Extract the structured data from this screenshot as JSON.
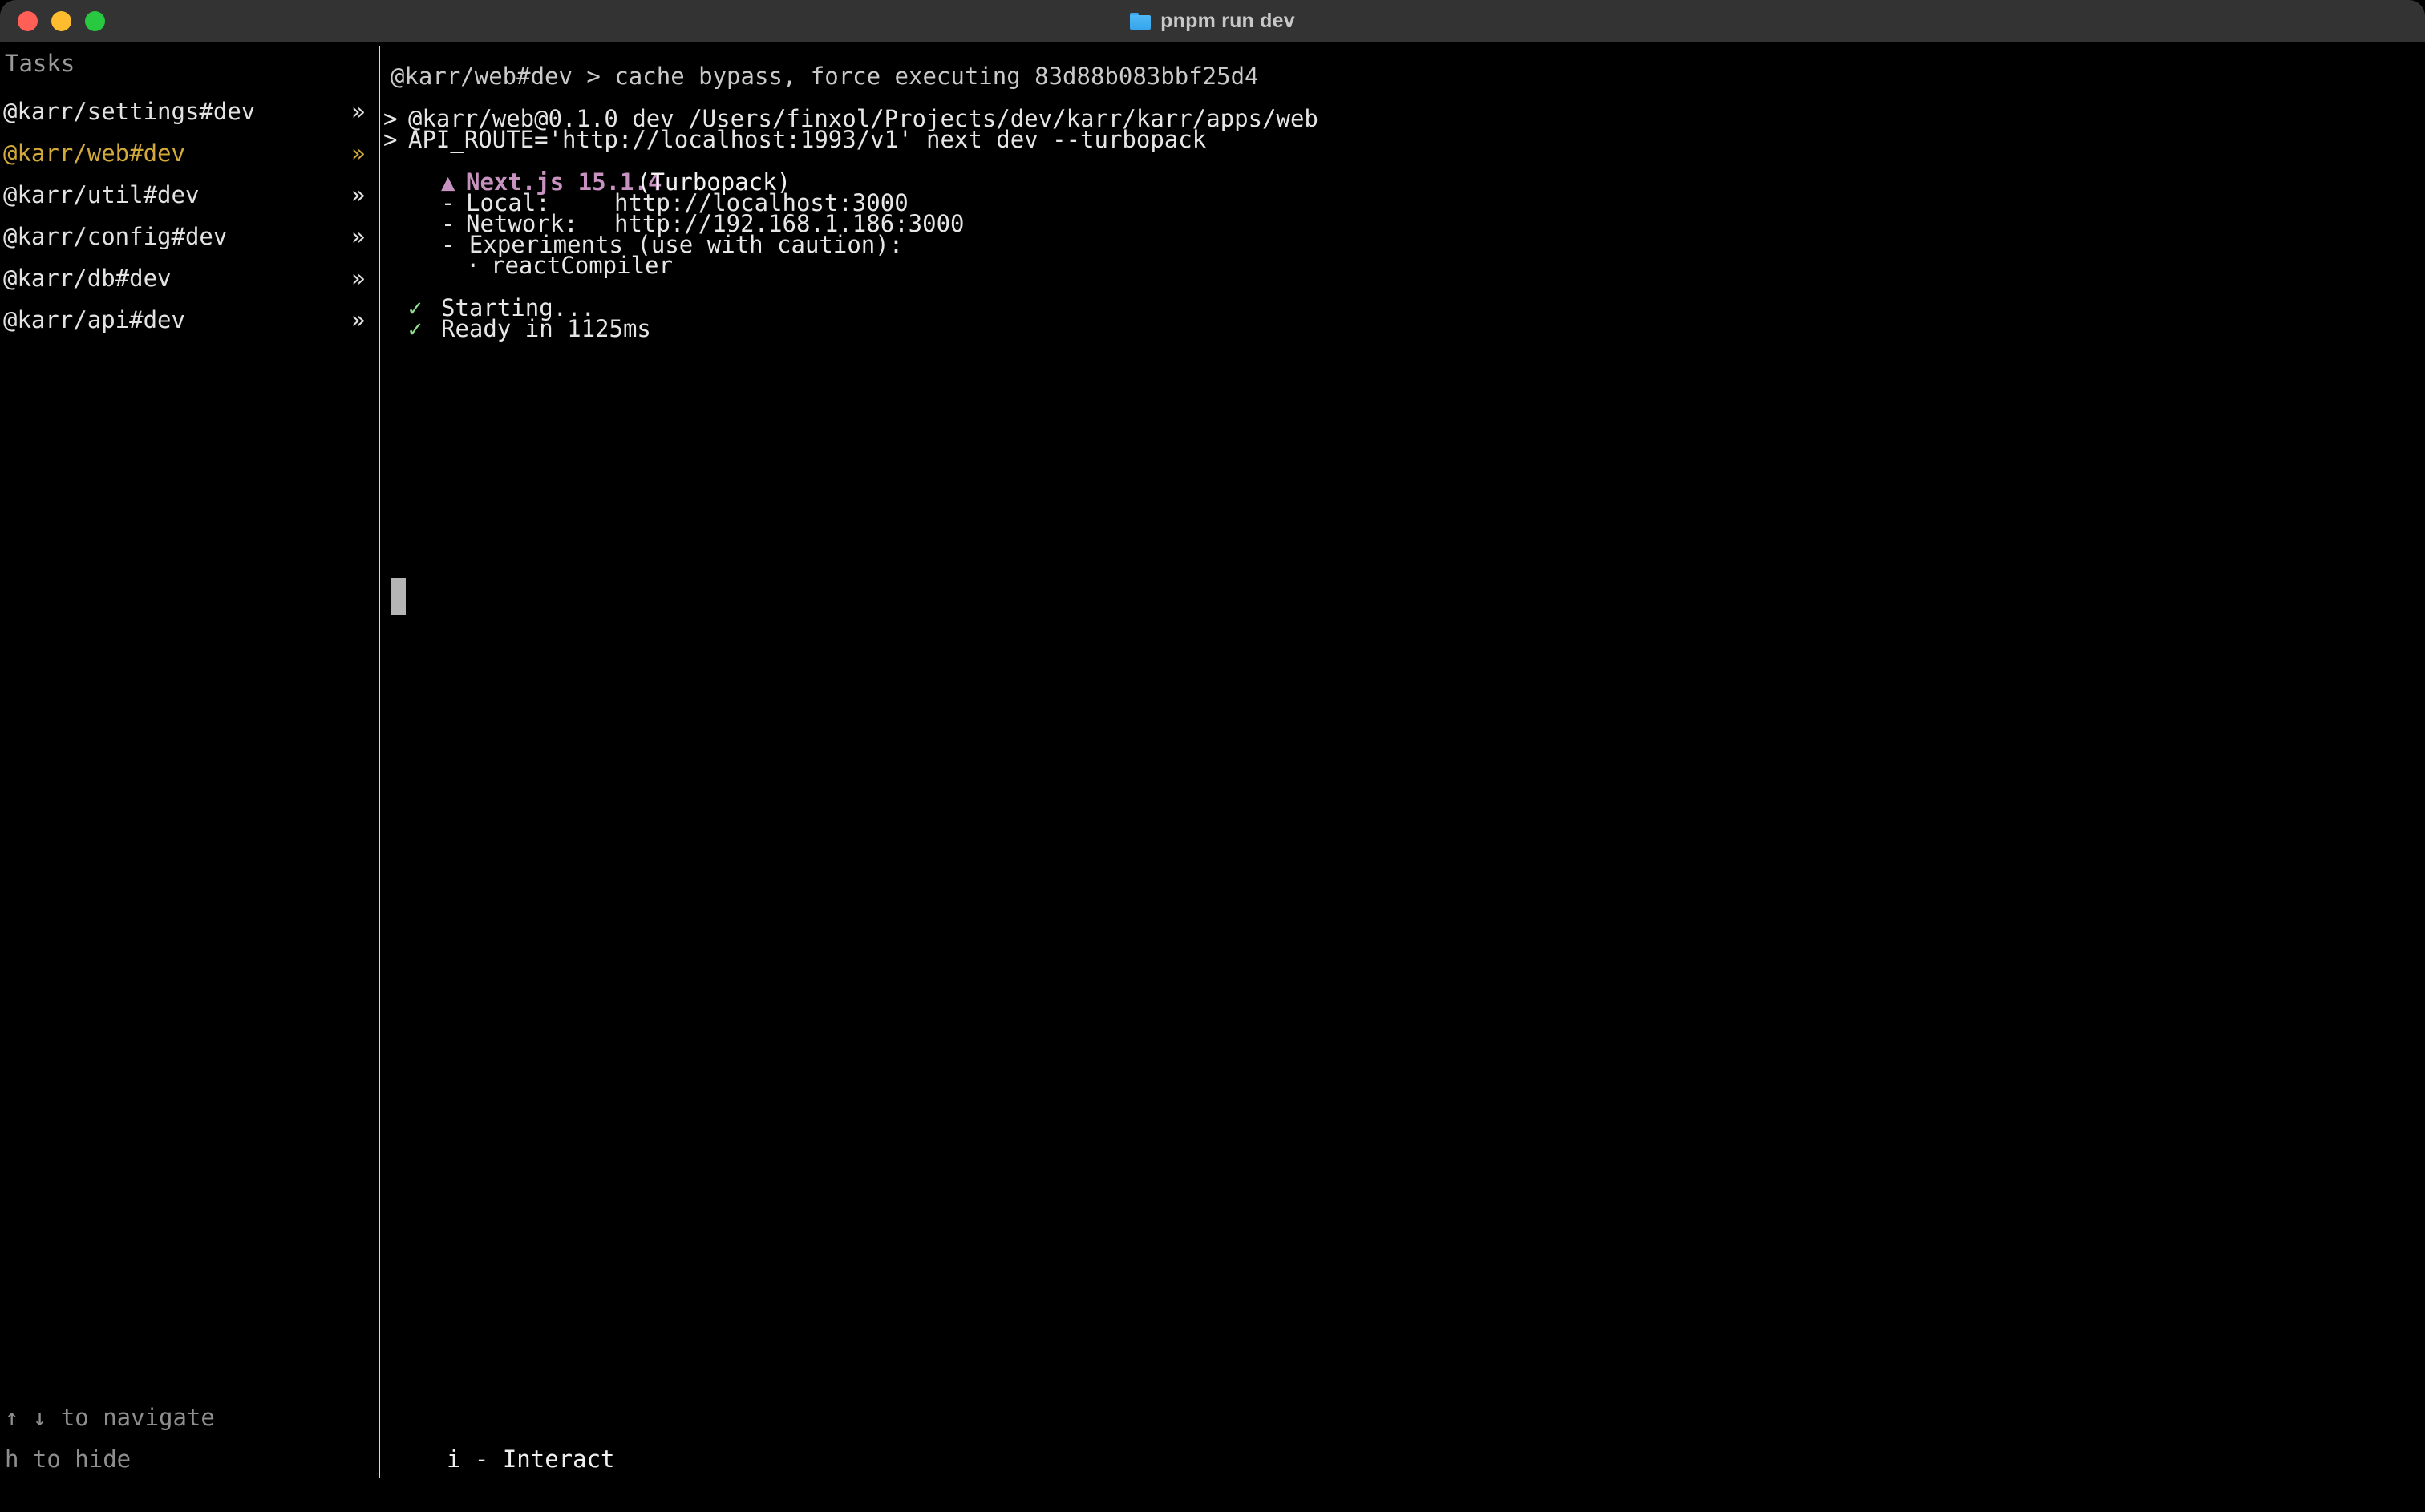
{
  "window": {
    "title": "pnpm run dev",
    "title_icon": "folder-icon",
    "traffic_lights": [
      {
        "name": "close",
        "color": "#ff5f57"
      },
      {
        "name": "minimize",
        "color": "#febc2e"
      },
      {
        "name": "maximize",
        "color": "#28c840"
      }
    ]
  },
  "sidebar": {
    "header": "Tasks",
    "chevron": "»",
    "selected_color": "#d2a93b",
    "items": [
      {
        "label": "@karr/settings#dev",
        "selected": false
      },
      {
        "label": "@karr/web#dev",
        "selected": true
      },
      {
        "label": "@karr/util#dev",
        "selected": false
      },
      {
        "label": "@karr/config#dev",
        "selected": false
      },
      {
        "label": "@karr/db#dev",
        "selected": false
      },
      {
        "label": "@karr/api#dev",
        "selected": false
      }
    ],
    "hints": [
      "↑ ↓ to navigate",
      "h to hide"
    ]
  },
  "terminal": {
    "cache_line": "@karr/web#dev > cache bypass, force executing 83d88b083bbf25d4",
    "command_prompt_1": ">",
    "command_line_1": "@karr/web@0.1.0 dev /Users/finxol/Projects/dev/karr/karr/apps/web",
    "command_prompt_2": ">",
    "command_line_2": "API_ROUTE='http://localhost:1993/v1' next dev --turbopack",
    "banner": {
      "triangle": "▲",
      "name": "Next.js 15.1.4",
      "bundler": "(Turbopack)",
      "name_color": "#c792c0",
      "rows": [
        {
          "bullet": "-",
          "label": "Local:",
          "value": "http://localhost:3000"
        },
        {
          "bullet": "-",
          "label": "Network:",
          "value": "http://192.168.1.186:3000"
        }
      ],
      "experiments_label": "- Experiments (use with caution):",
      "experiments": [
        {
          "bullet": "·",
          "name": "reactCompiler"
        }
      ]
    },
    "status": [
      {
        "check": "✓",
        "text": "Starting...",
        "color": "#8ee08e"
      },
      {
        "check": "✓",
        "text": "Ready in 1125ms",
        "color": "#8ee08e"
      }
    ],
    "cursor": "block-cursor",
    "interact_hint": "i - Interact"
  }
}
